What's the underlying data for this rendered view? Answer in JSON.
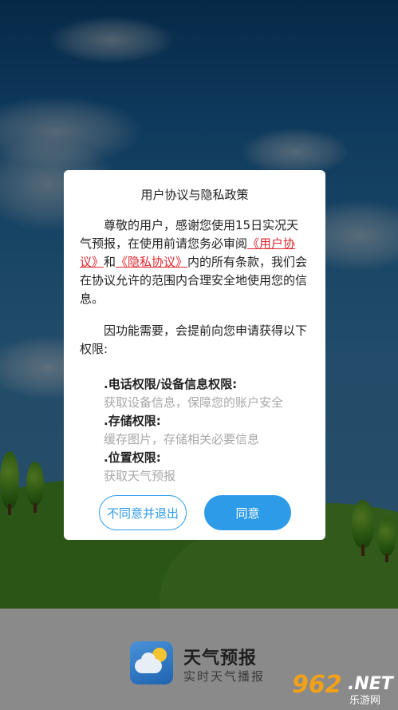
{
  "dialog": {
    "title": "用户协议与隐私政策",
    "p1_a": "尊敬的用户，感谢您使用15日实况天气预报，在使用前请您务必审阅",
    "p1_link1": "《用户协议》",
    "p1_and": "和",
    "p1_link2": "《隐私协议》",
    "p1_b": "内的所有条款，我们会在协议允许的范围内合理安全地使用您的信息。",
    "p2": "因功能需要，会提前向您申请获得以下权限:",
    "permissions": [
      {
        "title": ".电话权限/设备信息权限:",
        "desc": "获取设备信息，保障您的账户安全"
      },
      {
        "title": ".存储权限:",
        "desc": "缓存图片，存储相关必要信息"
      },
      {
        "title": ".位置权限:",
        "desc": "获取天气预报"
      }
    ],
    "decline_label": "不同意并退出",
    "agree_label": "同意"
  },
  "app": {
    "name": "天气预报",
    "slogan": "实时天气播报"
  },
  "watermark": {
    "num": "962",
    "net": ".NET",
    "cn": "乐游网"
  },
  "colors": {
    "accent": "#2d9be8",
    "link": "#e0262d"
  }
}
